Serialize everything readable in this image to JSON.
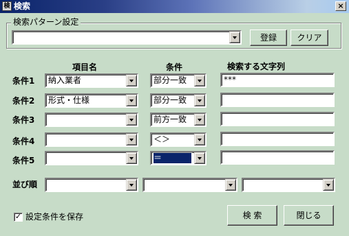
{
  "window": {
    "title": "検索",
    "app_icon_text": "検",
    "close_label": "×"
  },
  "pattern": {
    "group_label": "検索パターン設定",
    "value": "",
    "register_button": "登録",
    "clear_button": "クリア"
  },
  "headers": {
    "item_name": "項目名",
    "condition": "条件",
    "search_text": "検索する文字列"
  },
  "rows": [
    {
      "label": "条件1",
      "item": "納入業者",
      "cond": "部分一致",
      "text": "***"
    },
    {
      "label": "条件2",
      "item": "形式・仕様",
      "cond": "部分一致",
      "text": ""
    },
    {
      "label": "条件3",
      "item": "",
      "cond": "前方一致",
      "text": ""
    },
    {
      "label": "条件4",
      "item": "",
      "cond": "＜＞",
      "text": ""
    },
    {
      "label": "条件5",
      "item": "",
      "cond": "＝",
      "text": ""
    }
  ],
  "sort": {
    "label": "並び順",
    "values": [
      "",
      "",
      ""
    ]
  },
  "save_settings": {
    "label": "設定条件を保存",
    "checked": true,
    "check_mark": "✓"
  },
  "buttons": {
    "search": "検 索",
    "close": "閉じる"
  },
  "colors": {
    "background": "#c7dcc8",
    "title_start": "#0a246a",
    "selection": "#0a246a"
  }
}
